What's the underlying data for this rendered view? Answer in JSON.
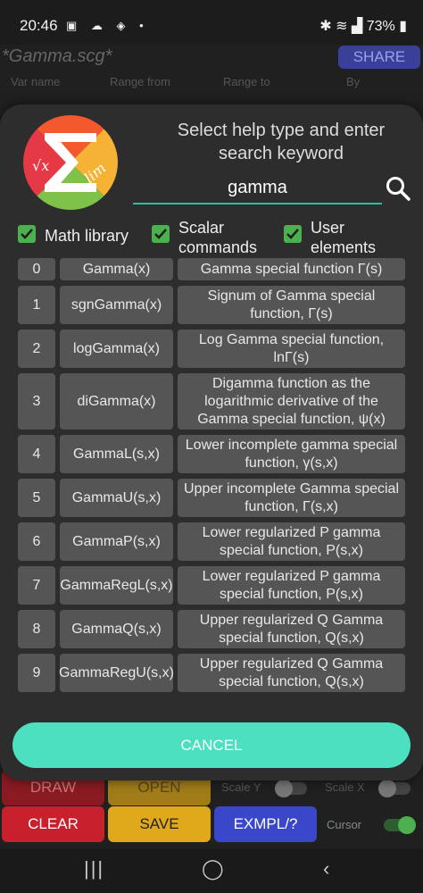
{
  "status_bar": {
    "time": "20:46",
    "battery": "73%"
  },
  "background_app": {
    "title": "*Gamma.scg*",
    "share_label": "SHARE",
    "columns": [
      "Var name",
      "Range from",
      "Range to",
      "By"
    ],
    "buttons": {
      "draw": "DRAW",
      "open": "OPEN",
      "clear": "CLEAR",
      "save": "SAVE",
      "example": "EXMPL/?"
    },
    "toggles": {
      "scale_y": "Scale Y",
      "scale_x": "Scale X",
      "cursor": "Cursor"
    }
  },
  "dialog": {
    "prompt": "Select help type and enter search keyword",
    "search_value": "gamma",
    "checkboxes": [
      {
        "label": "Math library",
        "checked": true
      },
      {
        "label": "Scalar commands",
        "checked": true
      },
      {
        "label": "User elements",
        "checked": true
      }
    ],
    "results": [
      {
        "index": "0",
        "name": "Gamma(x)",
        "desc": "Gamma special function Γ(s)"
      },
      {
        "index": "1",
        "name": "sgnGamma(x)",
        "desc": "Signum of Gamma special function, Γ(s)"
      },
      {
        "index": "2",
        "name": "logGamma(x)",
        "desc": "Log Gamma special function, lnΓ(s)"
      },
      {
        "index": "3",
        "name": "diGamma(x)",
        "desc": "Digamma function as the logarithmic derivative of the Gamma special function, ψ(x)"
      },
      {
        "index": "4",
        "name": "GammaL(s,x)",
        "desc": "Lower incomplete gamma special function, γ(s,x)"
      },
      {
        "index": "5",
        "name": "GammaU(s,x)",
        "desc": "Upper incomplete Gamma special function, Γ(s,x)"
      },
      {
        "index": "6",
        "name": "GammaP(s,x)",
        "desc": "Lower regularized P gamma special function, P(s,x)"
      },
      {
        "index": "7",
        "name": "GammaRegL(s,x)",
        "desc": "Lower regularized P gamma special function, P(s,x)"
      },
      {
        "index": "8",
        "name": "GammaQ(s,x)",
        "desc": "Upper regularized Q Gamma special function, Q(s,x)"
      },
      {
        "index": "9",
        "name": "GammaRegU(s,x)",
        "desc": "Upper regularized Q Gamma special function, Q(s,x)"
      }
    ],
    "cancel_label": "CANCEL"
  },
  "colors": {
    "accent": "#4ce0c0",
    "checkbox": "#4caf50",
    "cell": "#555555",
    "dialog": "#2d2d2d"
  }
}
